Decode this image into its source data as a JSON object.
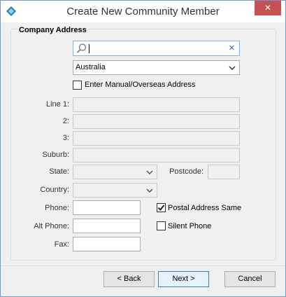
{
  "window": {
    "title": "Create New Community Member",
    "close_glyph": "✕"
  },
  "group": {
    "title": "Company Address"
  },
  "search": {
    "value": "",
    "clear_glyph": "✕"
  },
  "country_select": {
    "value": "Australia"
  },
  "manual_address": {
    "label": "Enter Manual/Overseas Address",
    "checked": false
  },
  "labels": {
    "line1": "Line 1:",
    "line2": "2:",
    "line3": "3:",
    "suburb": "Suburb:",
    "state": "State:",
    "postcode": "Postcode:",
    "country": "Country:",
    "phone": "Phone:",
    "alt_phone": "Alt Phone:",
    "fax": "Fax:"
  },
  "postal_same": {
    "label": "Postal Address Same",
    "checked": true
  },
  "silent_phone": {
    "label": "Silent Phone",
    "checked": false
  },
  "buttons": {
    "back": "< Back",
    "next": "Next >",
    "cancel": "Cancel"
  },
  "colors": {
    "accent": "#3c7fb1",
    "close_red": "#c75050",
    "search_border": "#7eb4ea"
  }
}
